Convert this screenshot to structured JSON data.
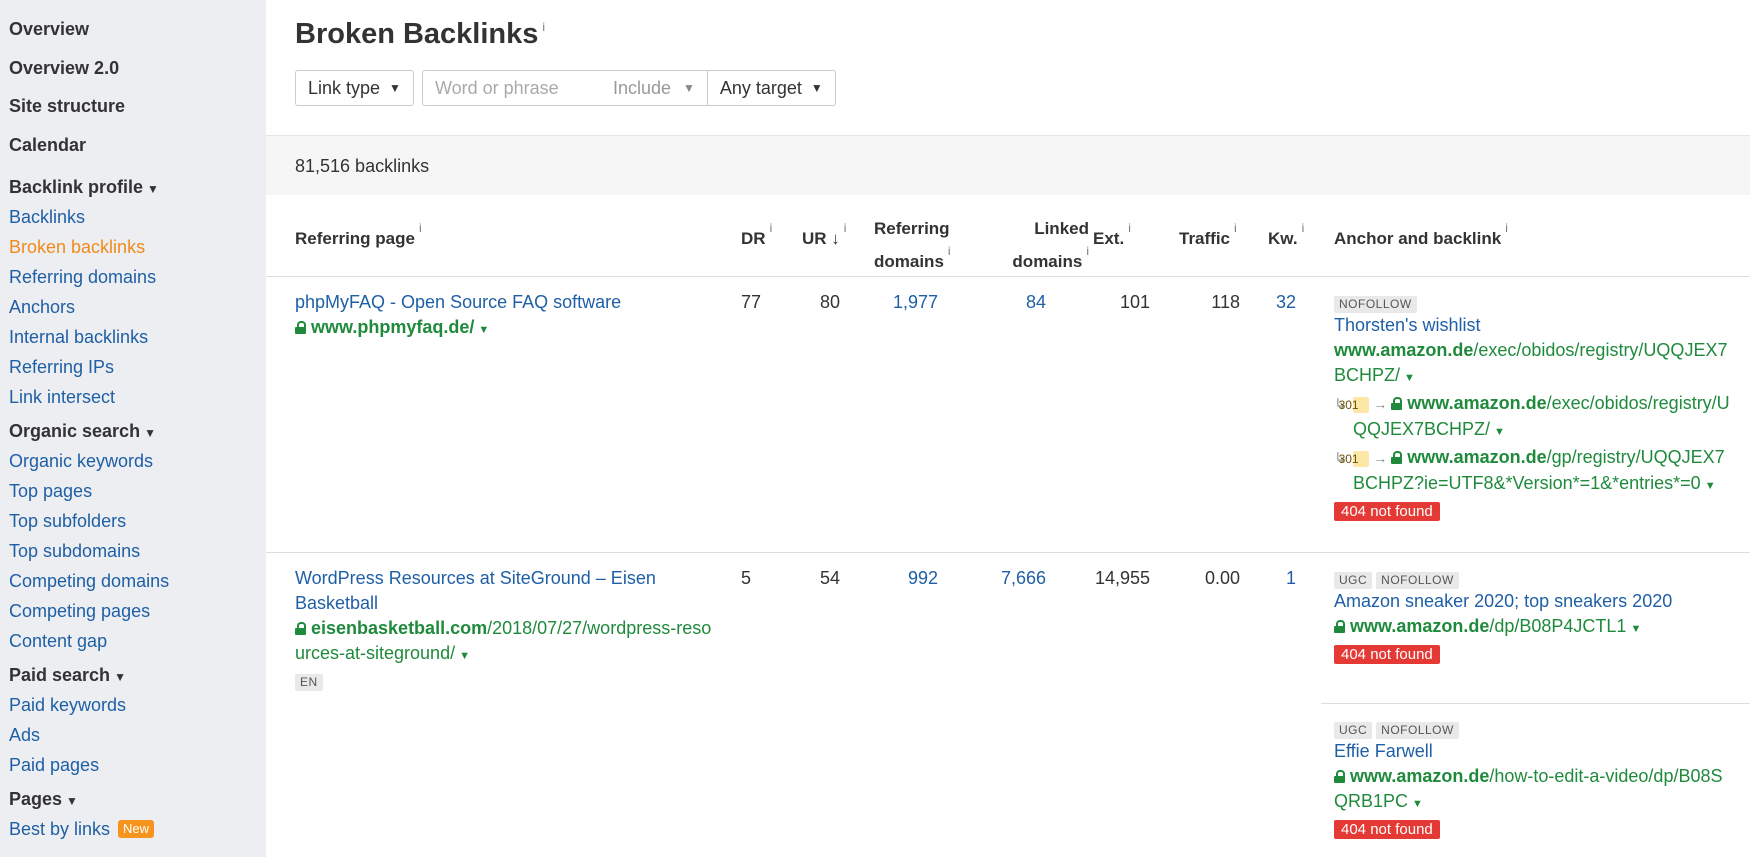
{
  "sidebar": {
    "top": [
      "Overview",
      "Overview 2.0",
      "Site structure",
      "Calendar"
    ],
    "sections": [
      {
        "title": "Backlink profile",
        "items": [
          "Backlinks",
          "Broken backlinks",
          "Referring domains",
          "Anchors",
          "Internal backlinks",
          "Referring IPs",
          "Link intersect"
        ]
      },
      {
        "title": "Organic search",
        "items": [
          "Organic keywords",
          "Top pages",
          "Top subfolders",
          "Top subdomains",
          "Competing domains",
          "Competing pages",
          "Content gap"
        ]
      },
      {
        "title": "Paid search",
        "items": [
          "Paid keywords",
          "Ads",
          "Paid pages"
        ]
      },
      {
        "title": "Pages",
        "items": [
          "Best by links"
        ]
      }
    ],
    "active_item": "Broken backlinks",
    "new_badge": "New",
    "caret": "▼"
  },
  "page": {
    "title": "Broken Backlinks",
    "info": "i"
  },
  "filters": {
    "link_type": "Link type",
    "search_placeholder": "Word or phrase",
    "include": "Include",
    "target": "Any target"
  },
  "count_label": "81,516 backlinks",
  "columns": {
    "referring_page": "Referring page",
    "dr": "DR",
    "ur": "UR",
    "ur_sort": "↓",
    "ref_domains_1": "Referring",
    "ref_domains_2": "domains",
    "linked_domains_1": "Linked",
    "linked_domains_2": "domains",
    "ext": "Ext.",
    "traffic": "Traffic",
    "kw": "Kw.",
    "anchor": "Anchor and backlink"
  },
  "rows": [
    {
      "title": "phpMyFAQ - Open Source FAQ software",
      "url_domain": "www.phpmyfaq.de/",
      "url_path": "",
      "lang": "",
      "dr": "77",
      "ur": "80",
      "ref_domains": "1,977",
      "linked_domains": "84",
      "ext": "101",
      "traffic": "118",
      "kw": "32",
      "anchors": [
        {
          "tags": [
            "NOFOLLOW"
          ],
          "text": "Thorsten's wishlist",
          "url_domain": "www.amazon.de",
          "url_path": "/exec/obidos/registry/UQQJEX7BCHPZ/",
          "redirects": [
            {
              "code": "301",
              "domain": "www.amazon.de",
              "path": "/exec/obidos/registry/UQQJEX7BCHPZ/"
            },
            {
              "code": "301",
              "domain": "www.amazon.de",
              "path": "/gp/registry/UQQJEX7BCHPZ?ie=UTF8&*Version*=1&*entries*=0"
            }
          ],
          "status": "404 not found"
        }
      ]
    },
    {
      "title": "WordPress Resources at SiteGround – Eisen Basketball",
      "url_domain": "eisenbasketball.com",
      "url_path": "/2018/07/27/wordpress-resources-at-siteground/",
      "lang": "EN",
      "dr": "5",
      "ur": "54",
      "ref_domains": "992",
      "linked_domains": "7,666",
      "ext": "14,955",
      "traffic": "0.00",
      "kw": "1",
      "anchors": [
        {
          "tags": [
            "UGC",
            "NOFOLLOW"
          ],
          "text": "Amazon sneaker 2020; top sneakers 2020",
          "url_domain": "www.amazon.de",
          "url_path": "/dp/B08P4JCTL1",
          "redirects": [],
          "status": "404 not found"
        },
        {
          "tags": [
            "UGC",
            "NOFOLLOW"
          ],
          "text": "Effie Farwell",
          "url_domain": "www.amazon.de",
          "url_path": "/how-to-edit-a-video/dp/B08SQRB1PC",
          "redirects": [],
          "status": "404 not found"
        }
      ]
    }
  ],
  "colors": {
    "link_blue": "#1f5fa6",
    "url_green": "#1f8a3c",
    "active_orange": "#f28a1a",
    "error_red": "#e53935",
    "sidebar_bg": "#eceef1"
  }
}
